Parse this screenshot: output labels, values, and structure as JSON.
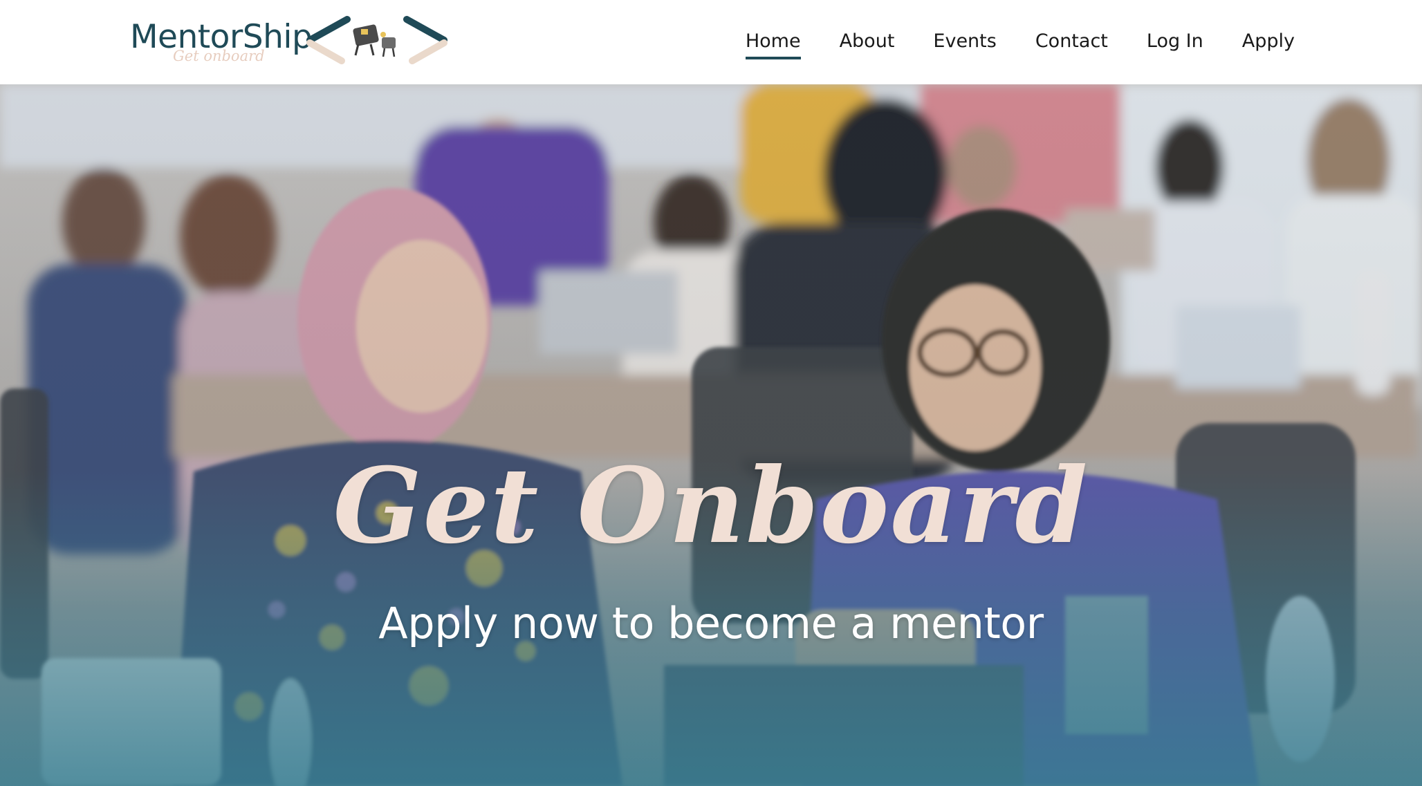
{
  "brand": {
    "name": "MentorShip",
    "tagline": "Get onboard",
    "logo_icon": "ship-arrows-logo-icon"
  },
  "nav": {
    "items": [
      {
        "label": "Home",
        "active": true
      },
      {
        "label": "About",
        "active": false
      },
      {
        "label": "Events",
        "active": false
      },
      {
        "label": "Contact",
        "active": false
      },
      {
        "label": "Log In",
        "active": false
      },
      {
        "label": "Apply",
        "active": false
      }
    ]
  },
  "hero": {
    "title": "Get Onboard",
    "subtitle": "Apply now to become a mentor",
    "image": "mentoring-event-photo"
  },
  "colors": {
    "brand": "#1f4a57",
    "accent": "#f1dfd5",
    "hero_overlay": "#3f7d91"
  }
}
